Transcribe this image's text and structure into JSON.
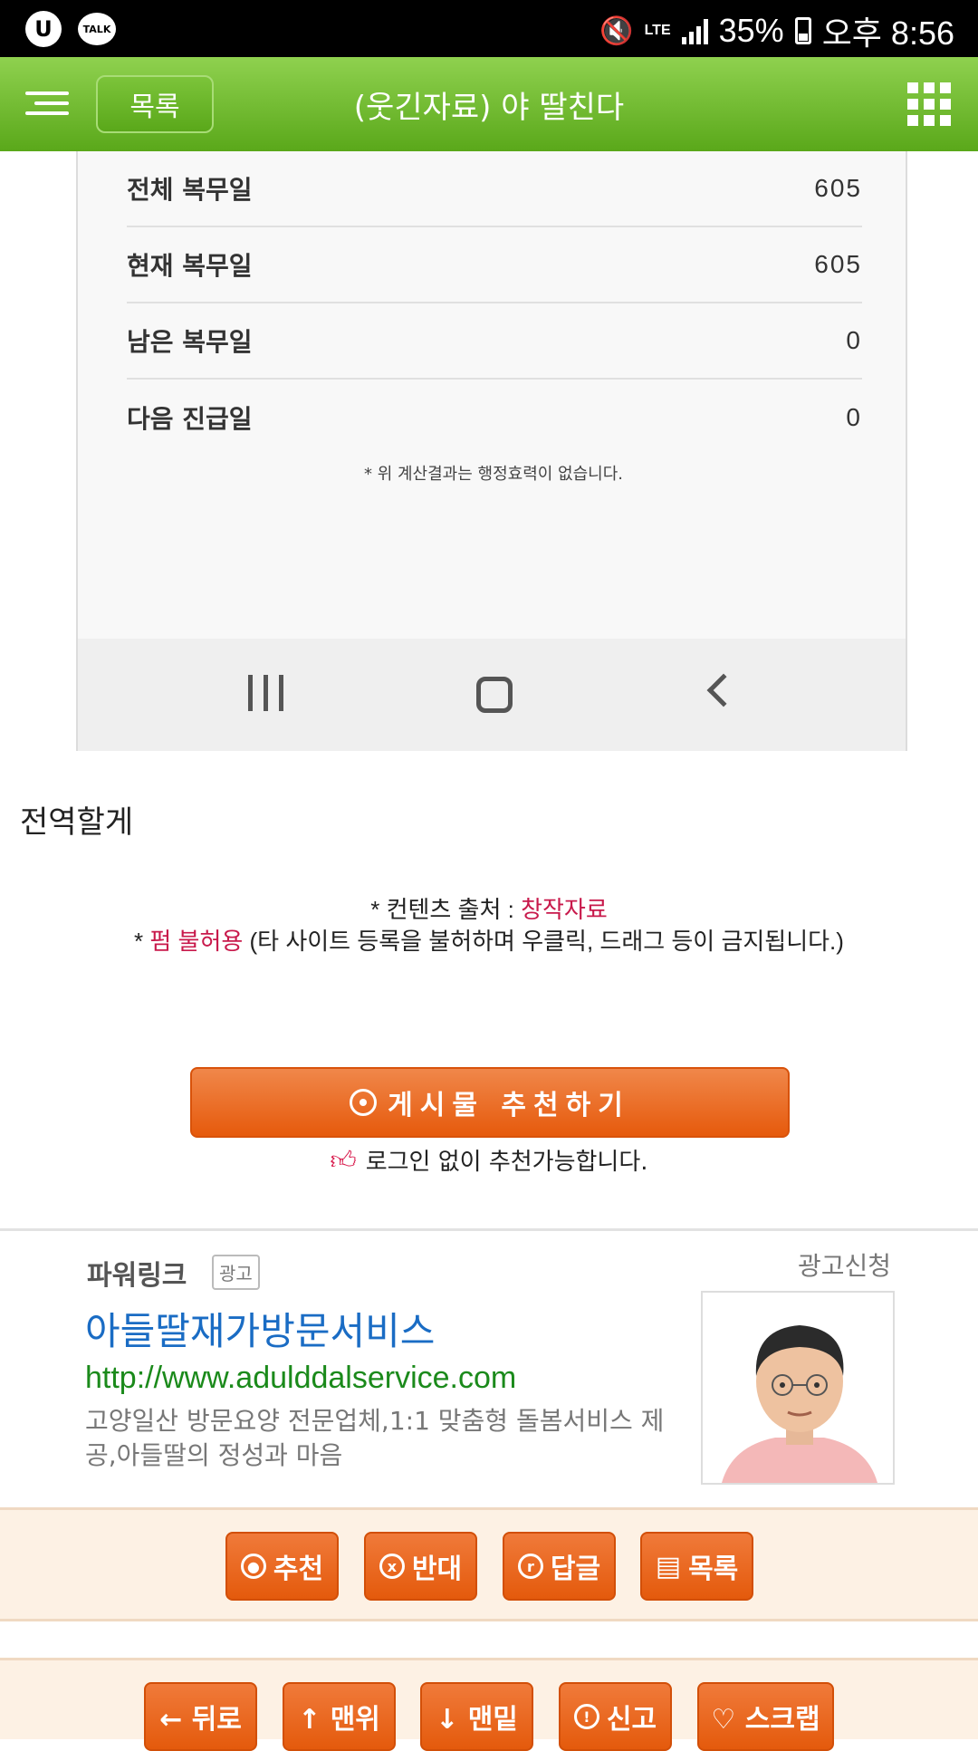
{
  "status_bar": {
    "left_icons": [
      "u-plus-icon",
      "kakaotalk-icon"
    ],
    "u_logo": "U",
    "talk_label": "TALK",
    "network": "LTE",
    "battery": "35%",
    "time": "오후 8:56"
  },
  "header": {
    "list_button": "목록",
    "title": "(웃긴자료) 야 딸친다"
  },
  "screenshot": {
    "rows": [
      {
        "label": "전체 복무일",
        "value": "605"
      },
      {
        "label": "현재 복무일",
        "value": "605"
      },
      {
        "label": "남은 복무일",
        "value": "0"
      },
      {
        "label": "다음 진급일",
        "value": "0"
      }
    ],
    "note": "* 위 계산결과는 행정효력이 없습니다."
  },
  "post": {
    "body": "전역할게",
    "source_prefix": "* 컨텐츠 출처 : ",
    "source_value": "창작자료",
    "copy_prefix": "* ",
    "copy_red": "펌 불허용",
    "copy_rest": " (타 사이트 등록을 불허하며 우클릭, 드래그 등이 금지됩니다.)"
  },
  "recommend": {
    "button": "게시물  추천하기",
    "note": "로그인 없이 추천가능합니다."
  },
  "ad": {
    "label": "파워링크",
    "badge": "광고",
    "apply": "광고신청",
    "title": "아들딸재가방문서비스",
    "url": "http://www.adulddalservice.com",
    "description": "고양일산 방문요양 전문업체,1:1 맞춤형 돌봄서비스 제공,아들딸의 정성과 마음"
  },
  "actions": [
    {
      "label": "추천",
      "icon": "circle-dot-icon"
    },
    {
      "label": "반대",
      "icon": "circle-x-icon"
    },
    {
      "label": "답글",
      "icon": "circle-r-icon"
    },
    {
      "label": "목록",
      "icon": "list-icon"
    }
  ],
  "nav_actions": [
    {
      "label": "← 뒤로"
    },
    {
      "label": "↑ 맨위"
    },
    {
      "label": "↓ 맨밑"
    },
    {
      "label": "신고",
      "icon": "report-icon"
    },
    {
      "label": "♡ 스크랩"
    }
  ],
  "colors": {
    "header_green": "#6ab82a",
    "accent_orange": "#e65a0c",
    "link_blue": "#1a6cc4",
    "url_green": "#1b8a1b",
    "highlight_red": "#c8194b"
  }
}
